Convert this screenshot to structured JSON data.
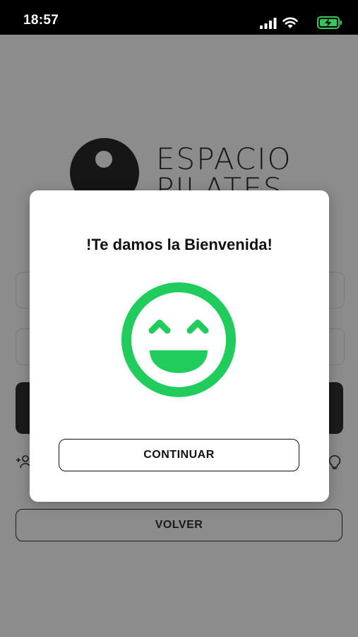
{
  "status_bar": {
    "time": "18:57",
    "icons": [
      "signal-icon",
      "wifi-icon",
      "battery-charging-icon"
    ],
    "battery_color": "#34c759"
  },
  "background": {
    "logo": {
      "line1": "ESPACIO",
      "line2": "PILATES"
    },
    "volver_label": "VOLVER",
    "icons": [
      "add-user-icon",
      "help-icon"
    ]
  },
  "modal": {
    "title": "!Te damos la Bienvenida!",
    "icon": "smiley-icon",
    "icon_color": "#1fcc5c",
    "continue_label": "CONTINUAR"
  }
}
